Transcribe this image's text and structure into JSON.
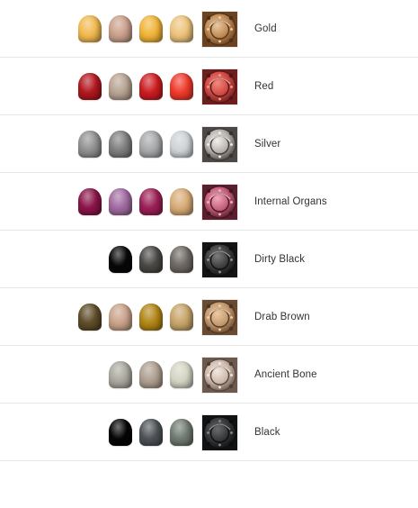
{
  "schemes": [
    {
      "name": "Gold",
      "icon": "gold-armor-icon",
      "swatch": {
        "light": "#e8c9a0",
        "mid": "#c08a55",
        "dark": "#6b4320"
      },
      "pots": [
        "#f1b94f",
        "#caa08c",
        "#f0b438",
        "#ecc37a"
      ],
      "pot_labels": [
        "gold-base-paint-pot",
        "gold-shade-paint-pot",
        "gold-layer-paint-pot",
        "gold-highlight-paint-pot"
      ]
    },
    {
      "name": "Red",
      "icon": "red-armor-icon",
      "swatch": {
        "light": "#f08a80",
        "mid": "#d24a45",
        "dark": "#6e1e1c"
      },
      "pots": [
        "#b0171d",
        "#b7a391",
        "#cc1c20",
        "#ee3a2a"
      ],
      "pot_labels": [
        "red-base-paint-pot",
        "red-shade-paint-pot",
        "red-layer-paint-pot",
        "red-highlight-paint-pot"
      ]
    },
    {
      "name": "Silver",
      "icon": "silver-armor-icon",
      "swatch": {
        "light": "#f2f0ee",
        "mid": "#b9b3ae",
        "dark": "#4d4845"
      },
      "pots": [
        "#909090",
        "#7e7e7e",
        "#a6a8aa",
        "#cdd2d6"
      ],
      "pot_labels": [
        "silver-base-paint-pot",
        "silver-shade-paint-pot",
        "silver-layer-paint-pot",
        "silver-highlight-paint-pot"
      ]
    },
    {
      "name": "Internal Organs",
      "icon": "internal-organs-armor-icon",
      "swatch": {
        "light": "#f0a8ba",
        "mid": "#c45f7a",
        "dark": "#5a1e2d"
      },
      "pots": [
        "#8a1449",
        "#a06aa0",
        "#9b1f56",
        "#d7ab76"
      ],
      "pot_labels": [
        "internal-organs-base-paint-pot",
        "internal-organs-shade-paint-pot",
        "internal-organs-layer-paint-pot",
        "internal-organs-highlight-paint-pot"
      ]
    },
    {
      "name": "Dirty Black",
      "icon": "dirty-black-armor-icon",
      "swatch": {
        "light": "#7c7c7c",
        "mid": "#3e3e3e",
        "dark": "#141414"
      },
      "pots": [
        "#080808",
        "#4a4845",
        "#6e6863"
      ],
      "pot_labels": [
        "dirty-black-base-paint-pot",
        "dirty-black-layer-paint-pot",
        "dirty-black-highlight-paint-pot"
      ]
    },
    {
      "name": "Drab Brown",
      "icon": "drab-brown-armor-icon",
      "swatch": {
        "light": "#eccaa3",
        "mid": "#c49a70",
        "dark": "#6a4a30"
      },
      "pots": [
        "#5e4b28",
        "#c8a28a",
        "#b18515",
        "#c6a469"
      ],
      "pot_labels": [
        "drab-brown-base-paint-pot",
        "drab-brown-shade-paint-pot",
        "drab-brown-layer-paint-pot",
        "drab-brown-highlight-paint-pot"
      ]
    },
    {
      "name": "Ancient Bone",
      "icon": "ancient-bone-armor-icon",
      "swatch": {
        "light": "#f4e8e0",
        "mid": "#cfb9ac",
        "dark": "#6c5a4f"
      },
      "pots": [
        "#aaa89e",
        "#ad9f91",
        "#d4d4c4"
      ],
      "pot_labels": [
        "ancient-bone-base-paint-pot",
        "ancient-bone-shade-paint-pot",
        "ancient-bone-highlight-paint-pot"
      ]
    },
    {
      "name": "Black",
      "icon": "black-armor-icon",
      "swatch": {
        "light": "#6a6c6e",
        "mid": "#35373a",
        "dark": "#111213"
      },
      "pots": [
        "#050505",
        "#4d5257",
        "#6f7a72"
      ],
      "pot_labels": [
        "black-base-paint-pot",
        "black-layer-paint-pot",
        "black-highlight-paint-pot"
      ]
    }
  ]
}
